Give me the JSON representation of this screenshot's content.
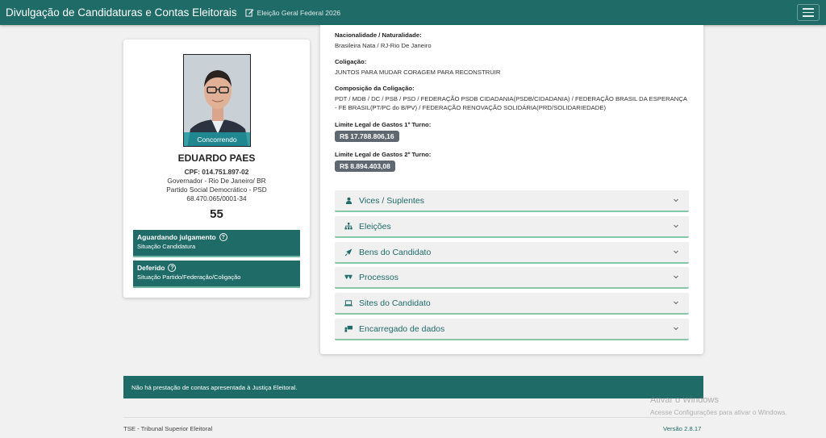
{
  "header": {
    "title": "Divulgação de Candidaturas e Contas Eleitorais",
    "election": "Eleição Geral Federal 2026",
    "icons": {
      "edit": "edit-icon",
      "menu": "menu-icon"
    }
  },
  "candidate": {
    "photo_badge": "Concorrendo",
    "name": "EDUARDO PAES",
    "cpf": "CPF: 014.751.897-02",
    "office": "Governador - Rio De Janeiro/ BR",
    "party": "Partido Social Democrático - PSD",
    "cnpj": "68.470.065/0001-34",
    "number": "55",
    "status": [
      {
        "title": "Aguardando julgamento",
        "subtitle": "Situação Candidatura"
      },
      {
        "title": "Deferido",
        "subtitle": "Situação Partido/Federação/Coligação"
      }
    ]
  },
  "details": {
    "nationality_label": "Nacionalidade / Naturalidade:",
    "nationality_value": "Brasileira Nata / RJ-Rio De Janeiro",
    "coalition_label": "Coligação:",
    "coalition_value": "JUNTOS PARA MUDAR CORAGEM PARA RECONSTRUIR",
    "composition_label": "Composição da Coligação:",
    "composition_value": "PDT / MDB / DC / PSB / PSD / FEDERAÇÃO PSDB CIDADANIA(PSDB/CIDADANIA) / FEDERAÇÃO BRASIL DA ESPERANÇA - FE BRASIL(PT/PC do B/PV) / FEDERAÇÃO RENOVAÇÃO SOLIDÁRIA(PRD/SOLIDARIEDADE)",
    "limit1_label": "Limite Legal de Gastos 1º Turno:",
    "limit1_value": "R$ 17.788.806,16",
    "limit2_label": "Limite Legal de Gastos 2º Turno:",
    "limit2_value": "R$ 8.894.403,08"
  },
  "accordion": [
    {
      "label": "Vices / Suplentes",
      "icon": "person-icon"
    },
    {
      "label": "Eleições",
      "icon": "sitemap-icon"
    },
    {
      "label": "Bens do Candidato",
      "icon": "rocket-icon"
    },
    {
      "label": "Processos",
      "icon": "scale-icon"
    },
    {
      "label": "Sites do Candidato",
      "icon": "laptop-icon"
    },
    {
      "label": "Encarregado de dados",
      "icon": "person-board-icon"
    }
  ],
  "notice": "Não há prestação de contas apresentada à Justiça Eleitoral.",
  "footer": {
    "left": "TSE - Tribunal Superior Eleitoral",
    "version": "Versão 2.8.17"
  },
  "watermark": {
    "title": "Ativar o Windows",
    "subtitle": "Acesse Configurações para ativar o Windows."
  },
  "colors": {
    "primary": "#1e6b68",
    "accent_line": "#8cc4a8",
    "money_badge": "#5f6870"
  }
}
